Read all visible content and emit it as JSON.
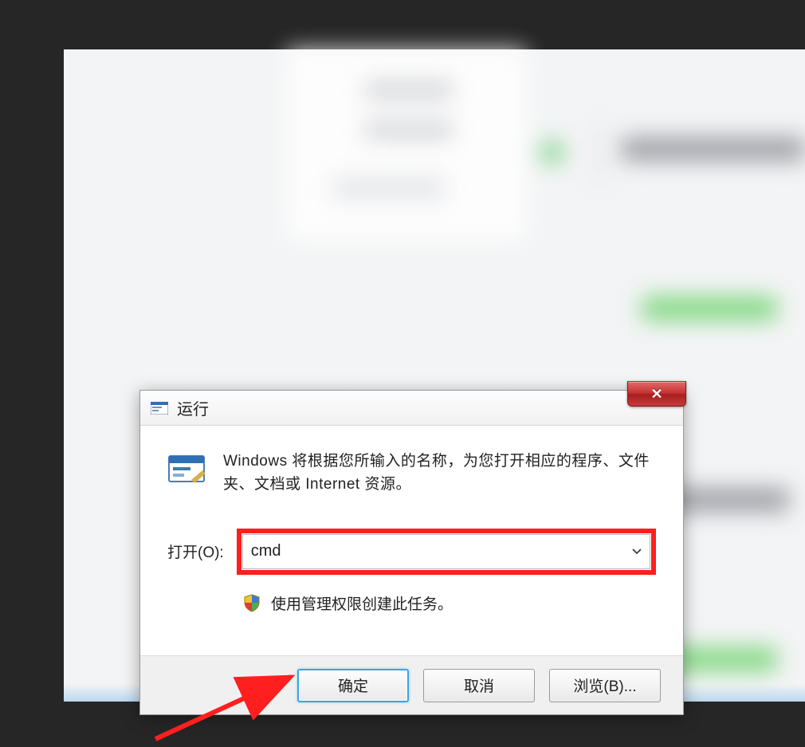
{
  "dialog": {
    "title": "运行",
    "description": "Windows 将根据您所输入的名称，为您打开相应的程序、文件夹、文档或 Internet 资源。",
    "open_label": "打开(O):",
    "input_value": "cmd",
    "admin_note": "使用管理权限创建此任务。",
    "buttons": {
      "ok": "确定",
      "cancel": "取消",
      "browse": "浏览(B)..."
    },
    "close_glyph": "✕"
  },
  "icons": {
    "run": "run-icon",
    "shield": "shield-icon",
    "close": "close-icon",
    "dropdown": "chevron-down-icon"
  },
  "annotation": {
    "highlight_color": "#ff1f1f",
    "arrow_color": "#ff1f1f"
  }
}
